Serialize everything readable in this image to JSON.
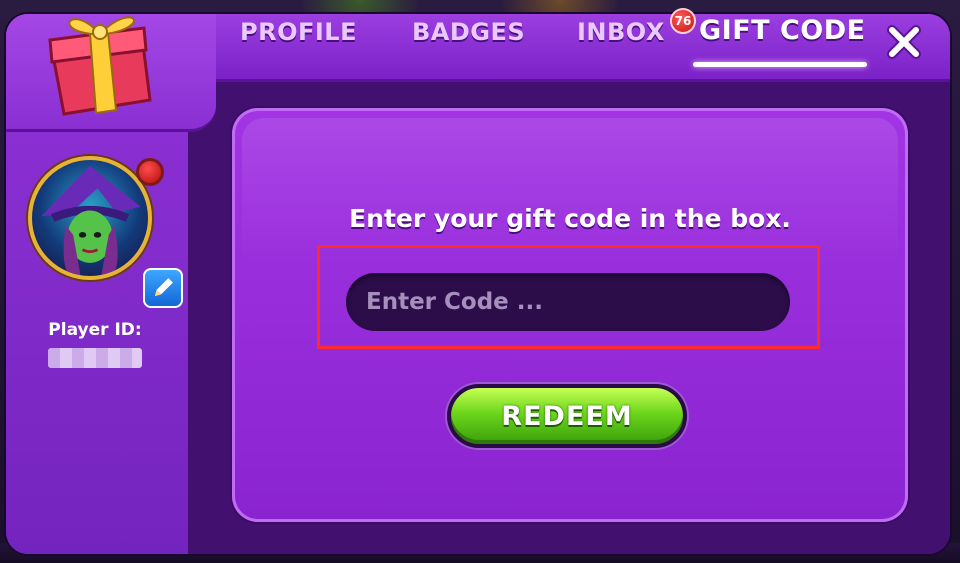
{
  "tabs": {
    "profile": "PROFILE",
    "badges": "BADGES",
    "inbox": "INBOX",
    "inbox_badge": "76",
    "gift_code": "GIFT CODE"
  },
  "sidebar": {
    "player_id_label": "Player ID:"
  },
  "panel": {
    "instruction": "Enter your gift code in the box.",
    "input_placeholder": "Enter Code ...",
    "input_value": "",
    "redeem_label": "REDEEM"
  },
  "colors": {
    "frame_purple": "#7a22c7",
    "panel_purple": "#9a2fdc",
    "input_bg": "#2c0d4a",
    "redeem_green": "#6cd61b",
    "highlight_red": "#ff2a2a",
    "badge_red": "#c51414"
  },
  "icons": {
    "gift": "gift-box-icon",
    "close": "close-icon",
    "edit": "edit-pencil-icon",
    "notification": "notification-dot-icon"
  }
}
